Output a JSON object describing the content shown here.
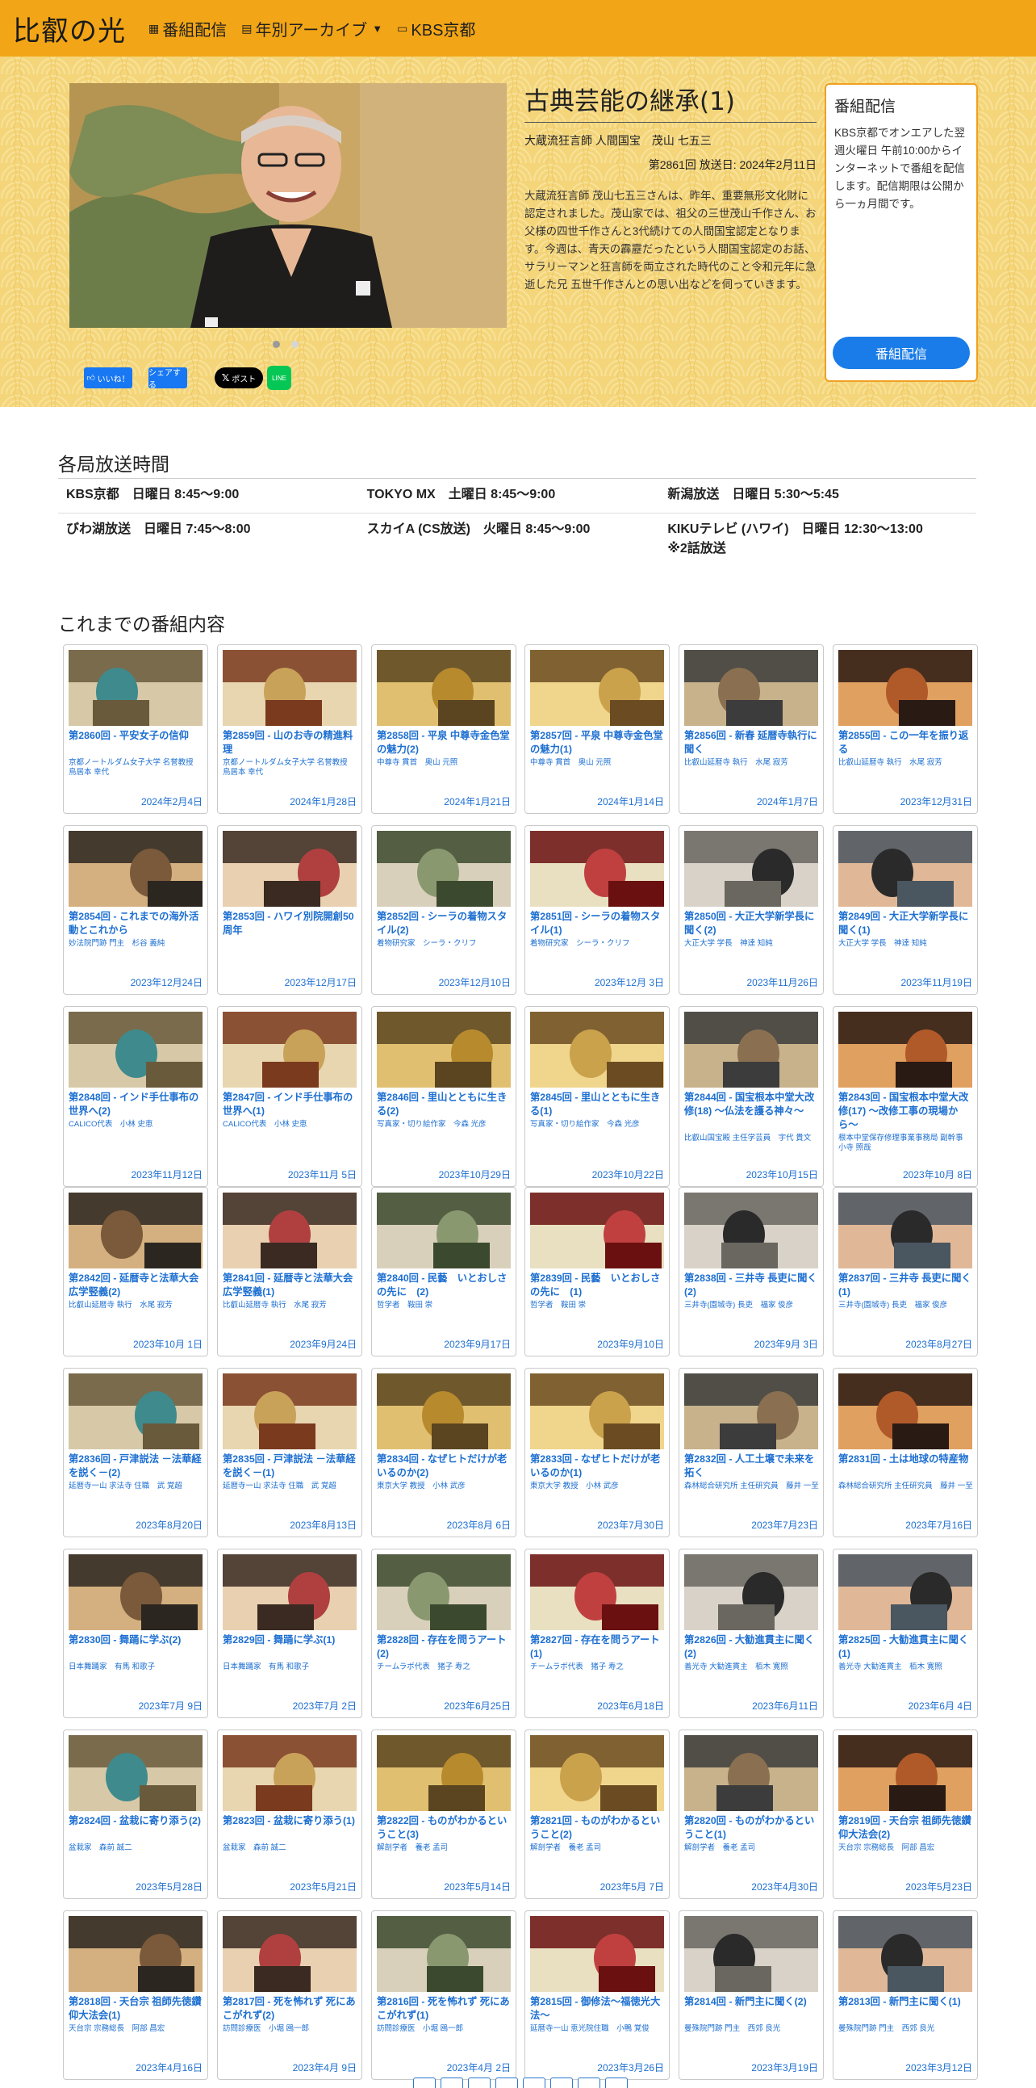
{
  "nav": {
    "brand": "比叡の光",
    "items": [
      {
        "icon": "grid-icon",
        "label": "番組配信"
      },
      {
        "icon": "archive-icon",
        "label": "年別アーカイブ",
        "dropdown": true
      },
      {
        "icon": "tv-icon",
        "label": "KBS京都"
      }
    ]
  },
  "hero": {
    "title": "古典芸能の継承(1)",
    "guest": "大蔵流狂言師 人間国宝　茂山 七五三",
    "air": "第2861回 放送日: 2024年2月11日",
    "description": "大蔵流狂言師 茂山七五三さんは、昨年、重要無形文化財に認定されました。茂山家では、祖父の三世茂山千作さん、お父様の四世千作さんと3代続けての人間国宝認定となります。今週は、青天の霹靂だったという人間国宝認定のお話、サラリーマンと狂言師を両立された時代のこと令和元年に急逝した兄 五世千作さんとの思い出などを伺っていきます。",
    "slides_total": 2,
    "slide_active": 1
  },
  "distribution": {
    "heading": "番組配信",
    "text": "KBS京都でオンエアした翌週火曜日 午前10:00からインターネットで番組を配信します。配信期限は公開から一ヵ月間です。",
    "button": "番組配信"
  },
  "share": {
    "like": "いいね！",
    "share": "シェアする",
    "x": "ポスト",
    "line": "LINE"
  },
  "schedule": {
    "title": "各局放送時間",
    "rows": [
      [
        "KBS京都　日曜日 8:45〜9:00",
        "TOKYO MX　土曜日 8:45〜9:00",
        "新潟放送　日曜日 5:30〜5:45"
      ],
      [
        "びわ湖放送　日曜日 7:45〜8:00",
        "スカイA (CS放送)　火曜日 8:45〜9:00",
        "KIKUテレビ (ハワイ)　日曜日 12:30〜13:00\n※2話放送"
      ]
    ]
  },
  "episodes": {
    "title": "これまでの番組内容",
    "items": [
      {
        "title": "第2860回 - 平安女子の信仰",
        "guest": "京都ノートルダム女子大学 名誉教授　鳥居本 幸代",
        "date": "2024年2月4日"
      },
      {
        "title": "第2859回 - 山のお寺の精進料理",
        "guest": "京都ノートルダム女子大学 名誉教授　鳥居本 幸代",
        "date": "2024年1月28日"
      },
      {
        "title": "第2858回 - 平泉 中尊寺金色堂の魅力(2)",
        "guest": "中尊寺 貫首　奥山 元照",
        "date": "2024年1月21日"
      },
      {
        "title": "第2857回 - 平泉 中尊寺金色堂の魅力(1)",
        "guest": "中尊寺 貫首　奥山 元照",
        "date": "2024年1月14日"
      },
      {
        "title": "第2856回 - 新春 延暦寺執行に聞く",
        "guest": "比叡山延暦寺 執行　水尾 寂芳",
        "date": "2024年1月7日"
      },
      {
        "title": "第2855回 - この一年を振り返る",
        "guest": "比叡山延暦寺 執行　水尾 寂芳",
        "date": "2023年12月31日"
      },
      {
        "title": "第2854回 - これまでの海外活動とこれから",
        "guest": "妙法院門跡 門主　杉谷 義純",
        "date": "2023年12月24日"
      },
      {
        "title": "第2853回 - ハワイ別院開創50周年",
        "guest": "",
        "date": "2023年12月17日"
      },
      {
        "title": "第2852回 - シーラの着物スタイル(2)",
        "guest": "着物研究家　シーラ・クリフ",
        "date": "2023年12月10日"
      },
      {
        "title": "第2851回 - シーラの着物スタイル(1)",
        "guest": "着物研究家　シーラ・クリフ",
        "date": "2023年12月 3日"
      },
      {
        "title": "第2850回 - 大正大学新学長に聞く(2)",
        "guest": "大正大学 学長　神達 知純",
        "date": "2023年11月26日"
      },
      {
        "title": "第2849回 - 大正大学新学長に聞く(1)",
        "guest": "大正大学 学長　神達 知純",
        "date": "2023年11月19日"
      },
      {
        "title": "第2848回 - インド手仕事布の世界へ(2)",
        "guest": "CALICO代表　小林 史恵",
        "date": "2023年11月12日"
      },
      {
        "title": "第2847回 - インド手仕事布の世界へ(1)",
        "guest": "CALICO代表　小林 史恵",
        "date": "2023年11月 5日"
      },
      {
        "title": "第2846回 - 里山とともに生きる(2)",
        "guest": "写真家・切り絵作家　今森 光彦",
        "date": "2023年10月29日"
      },
      {
        "title": "第2845回 - 里山とともに生きる(1)",
        "guest": "写真家・切り絵作家　今森 光彦",
        "date": "2023年10月22日"
      },
      {
        "title": "第2844回 - 国宝根本中堂大改修(18) 〜仏法を護る神々〜",
        "guest": "比叡山国宝殿 主任学芸員　宇代 貴文",
        "date": "2023年10月15日"
      },
      {
        "title": "第2843回 - 国宝根本中堂大改修(17) 〜改修工事の現場から〜",
        "guest": "根本中堂保存修理事業事務局 副幹事　小寺 照哉",
        "date": "2023年10月 8日"
      },
      {
        "title": "第2842回 - 延暦寺と法華大会広学竪義(2)",
        "guest": "比叡山延暦寺 執行　水尾 寂芳",
        "date": "2023年10月 1日"
      },
      {
        "title": "第2841回 - 延暦寺と法華大会広学竪義(1)",
        "guest": "比叡山延暦寺 執行　水尾 寂芳",
        "date": "2023年9月24日"
      },
      {
        "title": "第2840回 - 民藝　いとおしさの先に　(2)",
        "guest": "哲学者　鞍田 崇",
        "date": "2023年9月17日"
      },
      {
        "title": "第2839回 - 民藝　いとおしさの先に　(1)",
        "guest": "哲学者　鞍田 崇",
        "date": "2023年9月10日"
      },
      {
        "title": "第2838回 - 三井寺 長吏に聞く(2)",
        "guest": "三井寺(園城寺) 長吏　福家 俊彦",
        "date": "2023年9月 3日"
      },
      {
        "title": "第2837回 - 三井寺 長吏に聞く(1)",
        "guest": "三井寺(園城寺) 長吏　福家 俊彦",
        "date": "2023年8月27日"
      },
      {
        "title": "第2836回 - 戸津説法 －法華経を説く－(2)",
        "guest": "延暦寺一山 求法寺 住職　武 覚超",
        "date": "2023年8月20日"
      },
      {
        "title": "第2835回 - 戸津説法 －法華経を説く－(1)",
        "guest": "延暦寺一山 求法寺 住職　武 覚超",
        "date": "2023年8月13日"
      },
      {
        "title": "第2834回 - なぜヒトだけが老いるのか(2)",
        "guest": "東京大学 教授　小林 武彦",
        "date": "2023年8月 6日"
      },
      {
        "title": "第2833回 - なぜヒトだけが老いるのか(1)",
        "guest": "東京大学 教授　小林 武彦",
        "date": "2023年7月30日"
      },
      {
        "title": "第2832回 - 人工土壌で未来を拓く",
        "guest": "森林総合研究所 主任研究員　藤井 一至",
        "date": "2023年7月23日"
      },
      {
        "title": "第2831回 - 土は地球の特産物",
        "guest": "森林総合研究所 主任研究員　藤井 一至",
        "date": "2023年7月16日"
      },
      {
        "title": "第2830回 - 舞踊に学ぶ(2)",
        "guest": "日本舞踊家　有馬 和歌子",
        "date": "2023年7月 9日"
      },
      {
        "title": "第2829回 - 舞踊に学ぶ(1)",
        "guest": "日本舞踊家　有馬 和歌子",
        "date": "2023年7月 2日"
      },
      {
        "title": "第2828回 - 存在を問うアート(2)",
        "guest": "チームラボ代表　猪子 寿之",
        "date": "2023年6月25日"
      },
      {
        "title": "第2827回 - 存在を問うアート(1)",
        "guest": "チームラボ代表　猪子 寿之",
        "date": "2023年6月18日"
      },
      {
        "title": "第2826回 - 大勧進貫主に聞く(2)",
        "guest": "善光寺 大勧進貫主　栢木 寛照",
        "date": "2023年6月11日"
      },
      {
        "title": "第2825回 - 大勧進貫主に聞く(1)",
        "guest": "善光寺 大勧進貫主　栢木 寛照",
        "date": "2023年6月 4日"
      },
      {
        "title": "第2824回 - 盆栽に寄り添う(2)",
        "guest": "盆栽家　森前 誠二",
        "date": "2023年5月28日"
      },
      {
        "title": "第2823回 - 盆栽に寄り添う(1)",
        "guest": "盆栽家　森前 誠二",
        "date": "2023年5月21日"
      },
      {
        "title": "第2822回 - ものがわかるということ(3)",
        "guest": "解剖学者　養老 孟司",
        "date": "2023年5月14日"
      },
      {
        "title": "第2821回 - ものがわかるということ(2)",
        "guest": "解剖学者　養老 孟司",
        "date": "2023年5月 7日"
      },
      {
        "title": "第2820回 - ものがわかるということ(1)",
        "guest": "解剖学者　養老 孟司",
        "date": "2023年4月30日"
      },
      {
        "title": "第2819回 - 天台宗 祖師先徳鑽仰大法会(2)",
        "guest": "天台宗 宗務総長　阿部 昌宏",
        "date": "2023年5月23日"
      },
      {
        "title": "第2818回 - 天台宗 祖師先徳鑽仰大法会(1)",
        "guest": "天台宗 宗務総長　阿部 昌宏",
        "date": "2023年4月16日"
      },
      {
        "title": "第2817回 - 死を怖れず 死にあこがれず(2)",
        "guest": "訪問診療医　小堀 鴎一郎",
        "date": "2023年4月 9日"
      },
      {
        "title": "第2816回 - 死を怖れず 死にあこがれず(1)",
        "guest": "訪問診療医　小堀 鴎一郎",
        "date": "2023年4月 2日"
      },
      {
        "title": "第2815回 - 御修法〜福徳光大法〜",
        "guest": "延暦寺一山 恵光院住職　小鴨 覚俊",
        "date": "2023年3月26日"
      },
      {
        "title": "第2814回 - 新門主に聞く(2)",
        "guest": "曼殊院門跡 門主　西郊 良光",
        "date": "2023年3月19日"
      },
      {
        "title": "第2813回 - 新門主に聞く(1)",
        "guest": "曼殊院門跡 門主　西郊 良光",
        "date": "2023年3月12日"
      }
    ]
  },
  "pagination": {
    "pages": 8
  },
  "colors": {
    "navbar": "#f2a516",
    "hero_bg": "#f4d57a",
    "link": "#1d6fd1",
    "accent_button": "#1a7ce8"
  }
}
